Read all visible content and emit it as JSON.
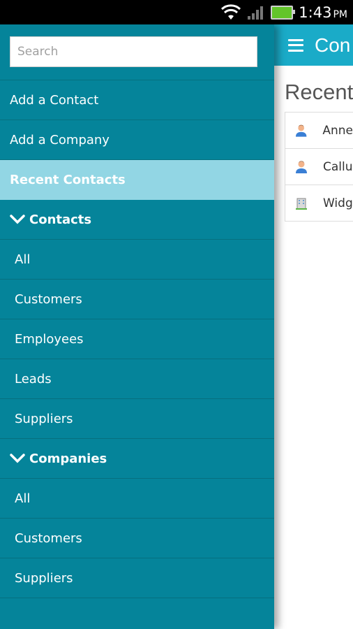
{
  "status_bar": {
    "time": "1:43",
    "ampm": "PM"
  },
  "main": {
    "app_title": "Con",
    "recent_heading": "Recent",
    "recent_items": [
      {
        "label": "Anne",
        "icon": "person-icon"
      },
      {
        "label": "Callu",
        "icon": "person-icon"
      },
      {
        "label": "Widg",
        "icon": "building-icon"
      }
    ]
  },
  "drawer": {
    "search_placeholder": "Search",
    "add_contact": "Add a Contact",
    "add_company": "Add a Company",
    "recent_contacts": "Recent Contacts",
    "contacts_section": "Contacts",
    "contacts_items": [
      "All",
      "Customers",
      "Employees",
      "Leads",
      "Suppliers"
    ],
    "companies_section": "Companies",
    "companies_items": [
      "All",
      "Customers",
      "Suppliers"
    ]
  },
  "colors": {
    "drawer_bg": "#05849a",
    "active_bg": "#92d6e4",
    "appbar_bg": "#1aabc8"
  }
}
